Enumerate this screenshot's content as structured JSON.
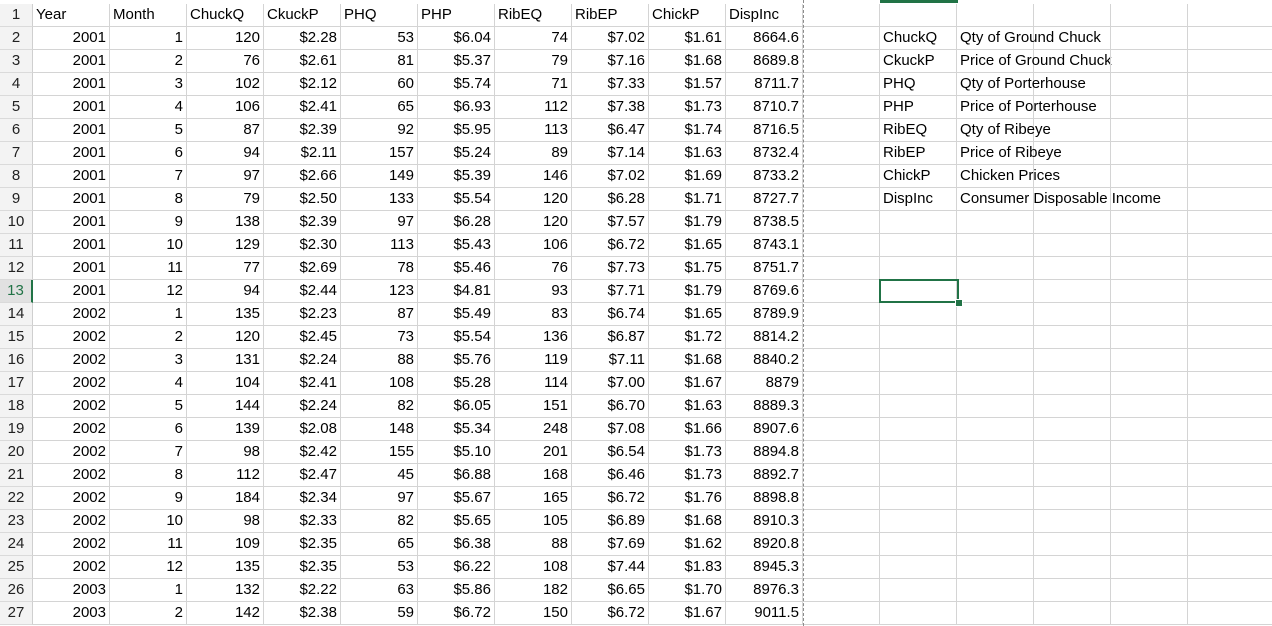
{
  "headers": [
    "Year",
    "Month",
    "ChuckQ",
    "CkuckP",
    "PHQ",
    "PHP",
    "RibEQ",
    "RibEP",
    "ChickP",
    "DispInc"
  ],
  "rows": [
    [
      "2001",
      "1",
      "120",
      "$2.28",
      "53",
      "$6.04",
      "74",
      "$7.02",
      "$1.61",
      "8664.6"
    ],
    [
      "2001",
      "2",
      "76",
      "$2.61",
      "81",
      "$5.37",
      "79",
      "$7.16",
      "$1.68",
      "8689.8"
    ],
    [
      "2001",
      "3",
      "102",
      "$2.12",
      "60",
      "$5.74",
      "71",
      "$7.33",
      "$1.57",
      "8711.7"
    ],
    [
      "2001",
      "4",
      "106",
      "$2.41",
      "65",
      "$6.93",
      "112",
      "$7.38",
      "$1.73",
      "8710.7"
    ],
    [
      "2001",
      "5",
      "87",
      "$2.39",
      "92",
      "$5.95",
      "113",
      "$6.47",
      "$1.74",
      "8716.5"
    ],
    [
      "2001",
      "6",
      "94",
      "$2.11",
      "157",
      "$5.24",
      "89",
      "$7.14",
      "$1.63",
      "8732.4"
    ],
    [
      "2001",
      "7",
      "97",
      "$2.66",
      "149",
      "$5.39",
      "146",
      "$7.02",
      "$1.69",
      "8733.2"
    ],
    [
      "2001",
      "8",
      "79",
      "$2.50",
      "133",
      "$5.54",
      "120",
      "$6.28",
      "$1.71",
      "8727.7"
    ],
    [
      "2001",
      "9",
      "138",
      "$2.39",
      "97",
      "$6.28",
      "120",
      "$7.57",
      "$1.79",
      "8738.5"
    ],
    [
      "2001",
      "10",
      "129",
      "$2.30",
      "113",
      "$5.43",
      "106",
      "$6.72",
      "$1.65",
      "8743.1"
    ],
    [
      "2001",
      "11",
      "77",
      "$2.69",
      "78",
      "$5.46",
      "76",
      "$7.73",
      "$1.75",
      "8751.7"
    ],
    [
      "2001",
      "12",
      "94",
      "$2.44",
      "123",
      "$4.81",
      "93",
      "$7.71",
      "$1.79",
      "8769.6"
    ],
    [
      "2002",
      "1",
      "135",
      "$2.23",
      "87",
      "$5.49",
      "83",
      "$6.74",
      "$1.65",
      "8789.9"
    ],
    [
      "2002",
      "2",
      "120",
      "$2.45",
      "73",
      "$5.54",
      "136",
      "$6.87",
      "$1.72",
      "8814.2"
    ],
    [
      "2002",
      "3",
      "131",
      "$2.24",
      "88",
      "$5.76",
      "119",
      "$7.11",
      "$1.68",
      "8840.2"
    ],
    [
      "2002",
      "4",
      "104",
      "$2.41",
      "108",
      "$5.28",
      "114",
      "$7.00",
      "$1.67",
      "8879"
    ],
    [
      "2002",
      "5",
      "144",
      "$2.24",
      "82",
      "$6.05",
      "151",
      "$6.70",
      "$1.63",
      "8889.3"
    ],
    [
      "2002",
      "6",
      "139",
      "$2.08",
      "148",
      "$5.34",
      "248",
      "$7.08",
      "$1.66",
      "8907.6"
    ],
    [
      "2002",
      "7",
      "98",
      "$2.42",
      "155",
      "$5.10",
      "201",
      "$6.54",
      "$1.73",
      "8894.8"
    ],
    [
      "2002",
      "8",
      "112",
      "$2.47",
      "45",
      "$6.88",
      "168",
      "$6.46",
      "$1.73",
      "8892.7"
    ],
    [
      "2002",
      "9",
      "184",
      "$2.34",
      "97",
      "$5.67",
      "165",
      "$6.72",
      "$1.76",
      "8898.8"
    ],
    [
      "2002",
      "10",
      "98",
      "$2.33",
      "82",
      "$5.65",
      "105",
      "$6.89",
      "$1.68",
      "8910.3"
    ],
    [
      "2002",
      "11",
      "109",
      "$2.35",
      "65",
      "$6.38",
      "88",
      "$7.69",
      "$1.62",
      "8920.8"
    ],
    [
      "2002",
      "12",
      "135",
      "$2.35",
      "53",
      "$6.22",
      "108",
      "$7.44",
      "$1.83",
      "8945.3"
    ],
    [
      "2003",
      "1",
      "132",
      "$2.22",
      "63",
      "$5.86",
      "182",
      "$6.65",
      "$1.70",
      "8976.3"
    ],
    [
      "2003",
      "2",
      "142",
      "$2.38",
      "59",
      "$6.72",
      "150",
      "$6.72",
      "$1.67",
      "9011.5"
    ]
  ],
  "row_numbers": [
    "1",
    "2",
    "3",
    "4",
    "5",
    "6",
    "7",
    "8",
    "9",
    "10",
    "11",
    "12",
    "13",
    "14",
    "15",
    "16",
    "17",
    "18",
    "19",
    "20",
    "21",
    "22",
    "23",
    "24",
    "25",
    "26",
    "27"
  ],
  "selected_row": "13",
  "legend": [
    [
      "ChuckQ",
      "Qty of Ground Chuck"
    ],
    [
      "CkuckP",
      "Price of Ground Chuck"
    ],
    [
      "PHQ",
      "Qty of Porterhouse"
    ],
    [
      "PHP",
      "Price of Porterhouse"
    ],
    [
      "RibEQ",
      "Qty of Ribeye"
    ],
    [
      "RibEP",
      "Price of Ribeye"
    ],
    [
      "ChickP",
      "Chicken Prices"
    ],
    [
      "DispInc",
      "Consumer Disposable Income"
    ]
  ],
  "colors": {
    "accent": "#217346",
    "gridline": "#d4d4d4",
    "header_bg": "#f3f3f3"
  }
}
